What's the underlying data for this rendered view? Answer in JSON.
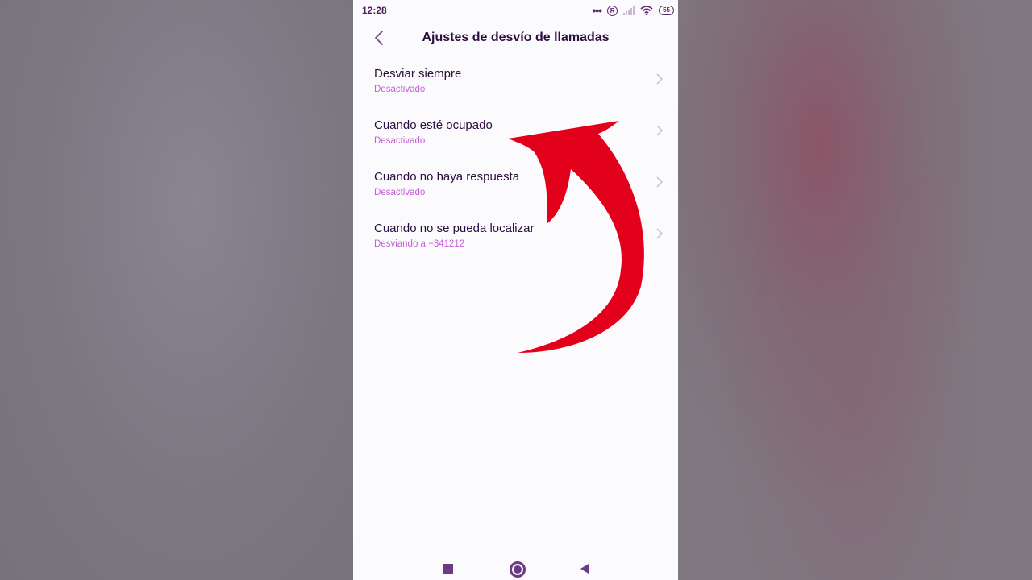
{
  "status_bar": {
    "time": "12:28",
    "dots": "•••",
    "r_icon": "R",
    "battery": "55",
    "icons": [
      "more-dots-icon",
      "registered-icon",
      "signal-icon",
      "wifi-icon",
      "battery-icon"
    ]
  },
  "header": {
    "title": "Ajustes de desvío de llamadas",
    "back_icon": "chevron-left-icon"
  },
  "items": [
    {
      "title": "Desviar siempre",
      "subtitle": "Desactivado"
    },
    {
      "title": "Cuando esté ocupado",
      "subtitle": "Desactivado"
    },
    {
      "title": "Cuando no haya respuesta",
      "subtitle": "Desactivado"
    },
    {
      "title": "Cuando no se pueda localizar",
      "subtitle": "Desviando a +341212"
    }
  ],
  "nav_bar": {
    "icons": [
      "recents-square-icon",
      "home-circle-icon",
      "back-triangle-icon"
    ]
  },
  "colors": {
    "accent": "#c65ed9",
    "title_text": "#2e0d3f",
    "icon": "#6b3a86",
    "annotation_arrow": "#e3001b"
  }
}
